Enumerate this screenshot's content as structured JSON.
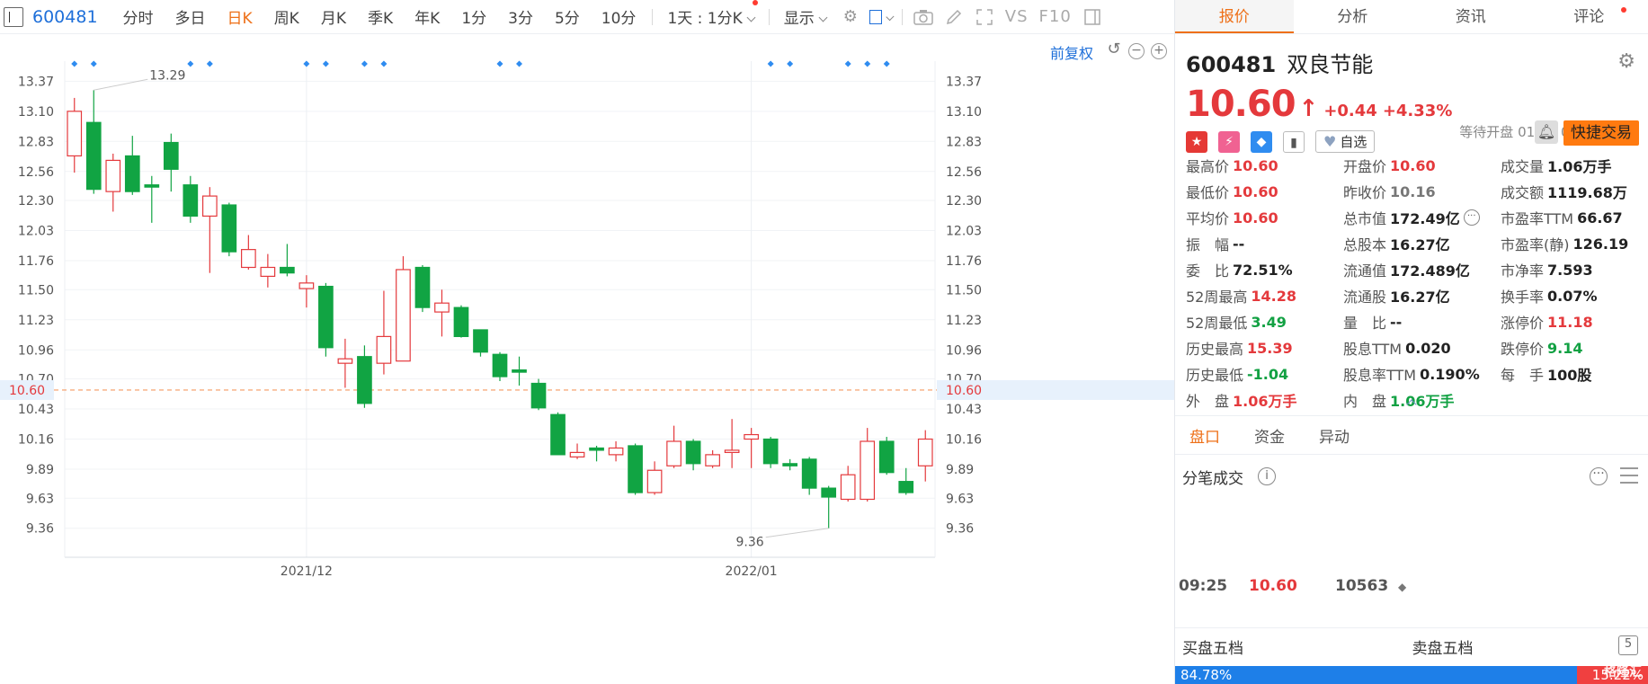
{
  "toolbar": {
    "code": "600481",
    "tabs": [
      {
        "label": "分时",
        "active": false
      },
      {
        "label": "多日",
        "active": false
      },
      {
        "label": "日K",
        "active": true
      },
      {
        "label": "周K",
        "active": false
      },
      {
        "label": "月K",
        "active": false
      },
      {
        "label": "季K",
        "active": false
      },
      {
        "label": "年K",
        "active": false
      },
      {
        "label": "1分",
        "active": false
      },
      {
        "label": "3分",
        "active": false
      },
      {
        "label": "5分",
        "active": false
      },
      {
        "label": "10分",
        "active": false
      }
    ],
    "period_dropdown": "1天 : 1分K",
    "display_dropdown": "显示",
    "vs_label": "VS",
    "f10_label": "F10"
  },
  "chart": {
    "adjust_label": "前复权",
    "current_price_label": "10.60"
  },
  "chart_data": {
    "type": "candlestick",
    "y_ticks": [
      "13.37",
      "13.10",
      "12.83",
      "12.56",
      "12.30",
      "12.03",
      "11.76",
      "11.50",
      "11.23",
      "10.96",
      "10.70",
      "10.43",
      "10.16",
      "9.89",
      "9.63",
      "9.36"
    ],
    "ylim": [
      9.1,
      13.55
    ],
    "x_ticks": [
      {
        "label": "2021/12",
        "index": 12
      },
      {
        "label": "2022/01",
        "index": 35
      }
    ],
    "current_price": 10.6,
    "max_annotation": {
      "label": "13.29",
      "index": 1,
      "value": 13.29
    },
    "min_annotation": {
      "label": "9.36",
      "index": 39,
      "value": 9.36
    },
    "candles": [
      {
        "o": 12.7,
        "c": 13.1,
        "h": 13.22,
        "l": 12.55
      },
      {
        "o": 13.0,
        "c": 12.4,
        "h": 13.29,
        "l": 12.36
      },
      {
        "o": 12.38,
        "c": 12.66,
        "h": 12.72,
        "l": 12.2
      },
      {
        "o": 12.7,
        "c": 12.38,
        "h": 12.88,
        "l": 12.35
      },
      {
        "o": 12.44,
        "c": 12.42,
        "h": 12.52,
        "l": 12.1
      },
      {
        "o": 12.82,
        "c": 12.58,
        "h": 12.9,
        "l": 12.38
      },
      {
        "o": 12.44,
        "c": 12.16,
        "h": 12.52,
        "l": 12.1
      },
      {
        "o": 12.16,
        "c": 12.34,
        "h": 12.42,
        "l": 11.65
      },
      {
        "o": 12.26,
        "c": 11.84,
        "h": 12.28,
        "l": 11.8
      },
      {
        "o": 11.7,
        "c": 11.86,
        "h": 11.99,
        "l": 11.68
      },
      {
        "o": 11.62,
        "c": 11.7,
        "h": 11.82,
        "l": 11.52
      },
      {
        "o": 11.7,
        "c": 11.65,
        "h": 11.91,
        "l": 11.62
      },
      {
        "o": 11.51,
        "c": 11.56,
        "h": 11.63,
        "l": 11.34
      },
      {
        "o": 11.53,
        "c": 10.98,
        "h": 11.56,
        "l": 10.9
      },
      {
        "o": 10.84,
        "c": 10.88,
        "h": 11.06,
        "l": 10.62
      },
      {
        "o": 10.9,
        "c": 10.48,
        "h": 11.0,
        "l": 10.44
      },
      {
        "o": 10.84,
        "c": 11.08,
        "h": 11.49,
        "l": 10.74
      },
      {
        "o": 10.86,
        "c": 11.68,
        "h": 11.8,
        "l": 10.86
      },
      {
        "o": 11.7,
        "c": 11.34,
        "h": 11.72,
        "l": 11.3
      },
      {
        "o": 11.3,
        "c": 11.38,
        "h": 11.5,
        "l": 11.08
      },
      {
        "o": 11.34,
        "c": 11.08,
        "h": 11.36,
        "l": 11.07
      },
      {
        "o": 11.14,
        "c": 10.94,
        "h": 11.14,
        "l": 10.9
      },
      {
        "o": 10.92,
        "c": 10.72,
        "h": 10.94,
        "l": 10.68
      },
      {
        "o": 10.78,
        "c": 10.76,
        "h": 10.9,
        "l": 10.64
      },
      {
        "o": 10.66,
        "c": 10.44,
        "h": 10.7,
        "l": 10.42
      },
      {
        "o": 10.38,
        "c": 10.02,
        "h": 10.4,
        "l": 10.02
      },
      {
        "o": 10.0,
        "c": 10.04,
        "h": 10.12,
        "l": 9.98
      },
      {
        "o": 10.08,
        "c": 10.06,
        "h": 10.1,
        "l": 9.96
      },
      {
        "o": 10.02,
        "c": 10.08,
        "h": 10.14,
        "l": 9.96
      },
      {
        "o": 10.1,
        "c": 9.68,
        "h": 10.12,
        "l": 9.66
      },
      {
        "o": 9.68,
        "c": 9.88,
        "h": 9.96,
        "l": 9.66
      },
      {
        "o": 9.92,
        "c": 10.14,
        "h": 10.28,
        "l": 9.9
      },
      {
        "o": 10.14,
        "c": 9.94,
        "h": 10.16,
        "l": 9.88
      },
      {
        "o": 9.92,
        "c": 10.02,
        "h": 10.06,
        "l": 9.9
      },
      {
        "o": 10.04,
        "c": 10.06,
        "h": 10.34,
        "l": 9.9
      },
      {
        "o": 10.16,
        "c": 10.2,
        "h": 10.26,
        "l": 9.9
      },
      {
        "o": 10.16,
        "c": 9.94,
        "h": 10.18,
        "l": 9.9
      },
      {
        "o": 9.94,
        "c": 9.92,
        "h": 9.98,
        "l": 9.88
      },
      {
        "o": 9.98,
        "c": 9.72,
        "h": 10.0,
        "l": 9.66
      },
      {
        "o": 9.72,
        "c": 9.64,
        "h": 9.74,
        "l": 9.36
      },
      {
        "o": 9.62,
        "c": 9.84,
        "h": 9.92,
        "l": 9.6
      },
      {
        "o": 9.62,
        "c": 10.14,
        "h": 10.26,
        "l": 9.6
      },
      {
        "o": 10.14,
        "c": 9.86,
        "h": 10.18,
        "l": 9.84
      },
      {
        "o": 9.78,
        "c": 9.68,
        "h": 9.9,
        "l": 9.66
      },
      {
        "o": 9.92,
        "c": 10.16,
        "h": 10.24,
        "l": 9.78
      }
    ],
    "event_marker_indices": [
      0,
      1,
      6,
      7,
      12,
      13,
      15,
      16,
      22,
      23,
      36,
      37,
      40,
      41,
      42
    ]
  },
  "panel": {
    "tabs": [
      "报价",
      "分析",
      "资讯",
      "评论"
    ],
    "code": "600481",
    "name": "双良节能",
    "price": "10.60",
    "arrow": "↑",
    "change": "+0.44",
    "change_pct": "+4.33%",
    "status": "等待开盘 01/18 09:30(北京)",
    "watch_label": "自选",
    "trade_label": "快捷交易",
    "quote": [
      [
        {
          "k": "最高价",
          "v": "10.60",
          "c": "red"
        },
        {
          "k": "开盘价",
          "v": "10.60",
          "c": "red"
        },
        {
          "k": "成交量",
          "v": "1.06万手",
          "c": ""
        }
      ],
      [
        {
          "k": "最低价",
          "v": "10.60",
          "c": "red"
        },
        {
          "k": "昨收价",
          "v": "10.16",
          "c": "gray"
        },
        {
          "k": "成交额",
          "v": "1119.68万",
          "c": ""
        }
      ],
      [
        {
          "k": "平均价",
          "v": "10.60",
          "c": "red"
        },
        {
          "k": "总市值",
          "v": "172.49亿",
          "c": "",
          "more": true
        },
        {
          "k": "市盈率TTM",
          "v": "66.67",
          "c": ""
        }
      ],
      [
        {
          "k": "振　幅",
          "v": "--",
          "c": ""
        },
        {
          "k": "总股本",
          "v": "16.27亿",
          "c": ""
        },
        {
          "k": "市盈率(静)",
          "v": "126.19",
          "c": ""
        }
      ],
      [
        {
          "k": "委　比",
          "v": "72.51%",
          "c": ""
        },
        {
          "k": "流通值",
          "v": "172.489亿",
          "c": ""
        },
        {
          "k": "市净率",
          "v": "7.593",
          "c": ""
        }
      ],
      [
        {
          "k": "52周最高",
          "v": "14.28",
          "c": "red"
        },
        {
          "k": "流通股",
          "v": "16.27亿",
          "c": ""
        },
        {
          "k": "换手率",
          "v": "0.07%",
          "c": ""
        }
      ],
      [
        {
          "k": "52周最低",
          "v": "3.49",
          "c": "green"
        },
        {
          "k": "量　比",
          "v": "--",
          "c": ""
        },
        {
          "k": "涨停价",
          "v": "11.18",
          "c": "red"
        }
      ],
      [
        {
          "k": "历史最高",
          "v": "15.39",
          "c": "red"
        },
        {
          "k": "股息TTM",
          "v": "0.020",
          "c": ""
        },
        {
          "k": "跌停价",
          "v": "9.14",
          "c": "green"
        }
      ],
      [
        {
          "k": "历史最低",
          "v": "-1.04",
          "c": "green"
        },
        {
          "k": "股息率TTM",
          "v": "0.190%",
          "c": ""
        },
        {
          "k": "每　手",
          "v": "100股",
          "c": ""
        }
      ],
      [
        {
          "k": "外　盘",
          "v": "1.06万手",
          "c": "red"
        },
        {
          "k": "内　盘",
          "v": "1.06万手",
          "c": "green"
        },
        {
          "k": "",
          "v": "",
          "c": ""
        }
      ]
    ],
    "sub_tabs": [
      "盘口",
      "资金",
      "异动"
    ],
    "tick_title": "分笔成交",
    "tick": {
      "time": "09:25",
      "price": "10.60",
      "volume": "10563"
    },
    "book": {
      "buy_title": "买盘五档",
      "sell_title": "卖盘五档",
      "buy_pct": "84.78%",
      "buy_ratio": 0.8478,
      "sell_pct": "15.22%",
      "watermark": "格隆汇"
    }
  },
  "colors": {
    "up": "#e4393c",
    "down": "#11a443",
    "accent": "#ee7018",
    "link": "#1e6fd9"
  }
}
